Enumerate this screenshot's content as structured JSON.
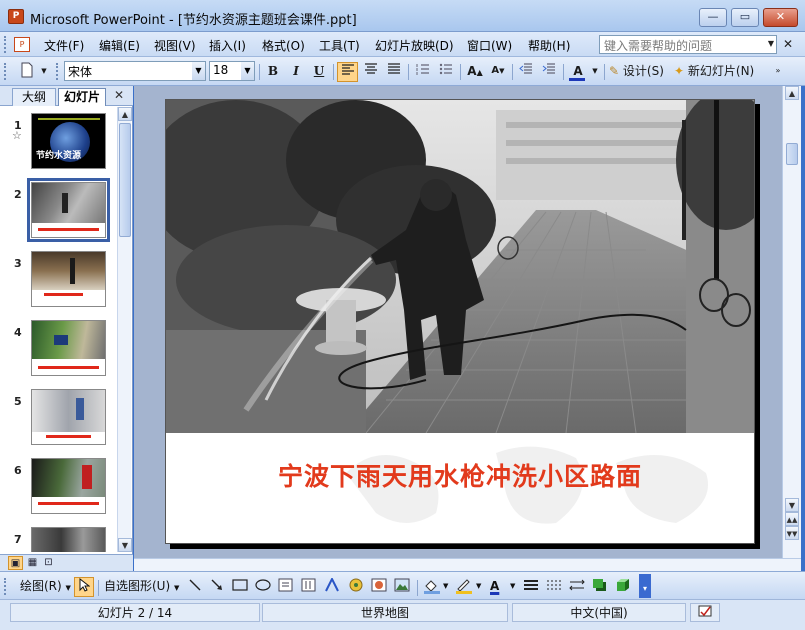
{
  "window": {
    "app_icon_text": "P",
    "title": "Microsoft PowerPoint - [节约水资源主题班会课件.ppt]",
    "min": "—",
    "max": "▭",
    "close": "✕"
  },
  "menu": {
    "items": [
      "文件(F)",
      "编辑(E)",
      "视图(V)",
      "插入(I)",
      "格式(O)",
      "工具(T)",
      "幻灯片放映(D)",
      "窗口(W)",
      "帮助(H)"
    ],
    "help_placeholder": "键入需要帮助的问题"
  },
  "toolbar": {
    "font_name": "宋体",
    "font_size": "18",
    "bold": "B",
    "italic": "I",
    "underline": "U",
    "design": "设计(S)",
    "new_slide": "新幻灯片(N)",
    "font_color": "A"
  },
  "left_pane": {
    "tab_outline": "大纲",
    "tab_slides": "幻灯片",
    "close": "✕",
    "slides": [
      {
        "num": "1",
        "star": "☆",
        "thumb_text": "节约水资源"
      },
      {
        "num": "2"
      },
      {
        "num": "3"
      },
      {
        "num": "4"
      },
      {
        "num": "5"
      },
      {
        "num": "6"
      },
      {
        "num": "7"
      }
    ],
    "selected_slide": 2
  },
  "slide": {
    "title": "宁波下雨天用水枪冲洗小区路面"
  },
  "drawing_toolbar": {
    "draw": "绘图(R)",
    "autoshapes": "自选图形(U)"
  },
  "status": {
    "slide_info": "幻灯片 2 / 14",
    "design_name": "世界地图",
    "language": "中文(中国)"
  },
  "colors": {
    "title_red": "#e23a1c",
    "window_blue": "#3a70c9"
  }
}
